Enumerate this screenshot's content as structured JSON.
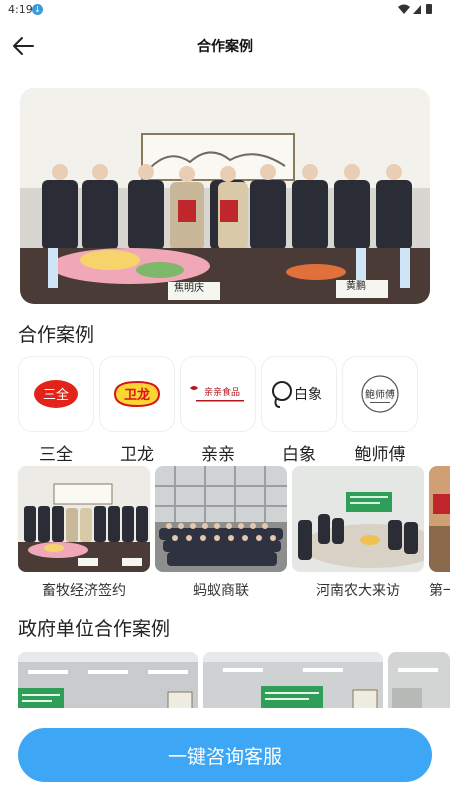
{
  "status_bar": {
    "time": "4:19"
  },
  "header": {
    "title": "合作案例"
  },
  "hero": {
    "nameplate_left": "焦明庆",
    "nameplate_right": "黄鹏"
  },
  "brands_section": {
    "title": "合作案例",
    "items": [
      {
        "label": "三全",
        "logo_text": "三全",
        "logo_color": "#e2231a"
      },
      {
        "label": "卫龙",
        "logo_text": "卫龙",
        "logo_color": "#d7141a"
      },
      {
        "label": "亲亲",
        "logo_text": "亲亲食品",
        "logo_color": "#b3171c"
      },
      {
        "label": "白象",
        "logo_text": "白象",
        "logo_color": "#222222"
      },
      {
        "label": "鲍师傅",
        "logo_text": "鲍师傅",
        "logo_color": "#333333"
      }
    ]
  },
  "cases_section": {
    "items": [
      {
        "label": "畜牧经济签约"
      },
      {
        "label": "蚂蚁商联"
      },
      {
        "label": "河南农大来访"
      },
      {
        "label": "第一"
      }
    ]
  },
  "gov_section": {
    "title": "政府单位合作案例"
  },
  "consult_button": {
    "label": "一键咨询客服"
  },
  "colors": {
    "accent": "#3da6f5"
  }
}
